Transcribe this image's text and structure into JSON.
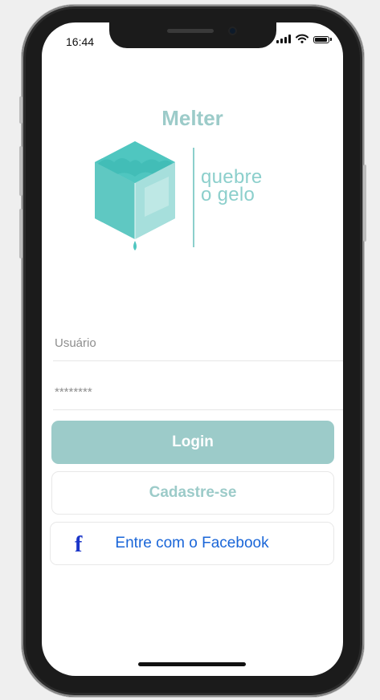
{
  "status_bar": {
    "time": "16:44"
  },
  "app": {
    "title": "Melter",
    "tagline_line1": "quebre",
    "tagline_line2": "o gelo",
    "accent_color": "#9ccbc9"
  },
  "form": {
    "username_placeholder": "Usuário",
    "password_placeholder": "********"
  },
  "buttons": {
    "login_label": "Login",
    "signup_label": "Cadastre-se",
    "facebook_label": "Entre com o Facebook",
    "facebook_icon": "facebook-f-icon",
    "facebook_icon_glyph": "f"
  }
}
